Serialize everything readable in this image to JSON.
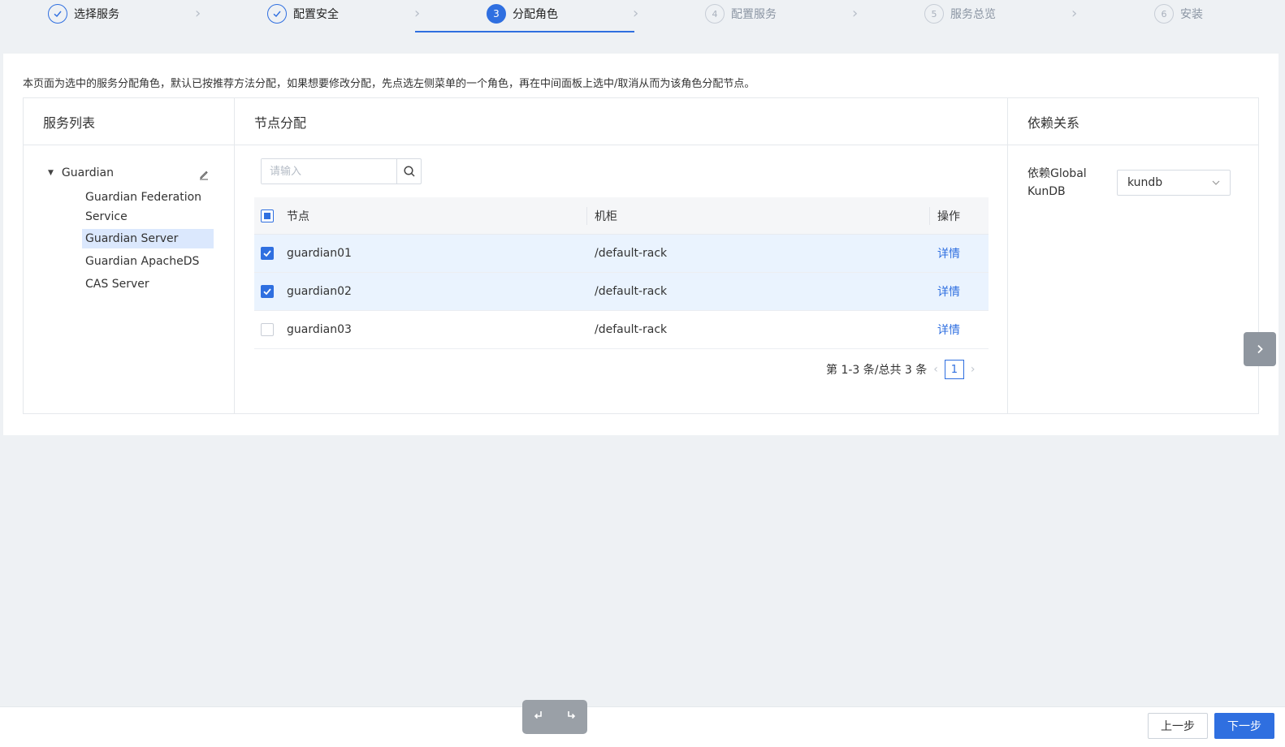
{
  "steps": [
    {
      "index": "1",
      "label": "选择服务",
      "state": "done"
    },
    {
      "index": "2",
      "label": "配置安全",
      "state": "done"
    },
    {
      "index": "3",
      "label": "分配角色",
      "state": "active"
    },
    {
      "index": "4",
      "label": "配置服务",
      "state": "pending"
    },
    {
      "index": "5",
      "label": "服务总览",
      "state": "pending"
    },
    {
      "index": "6",
      "label": "安装",
      "state": "pending"
    }
  ],
  "description": "本页面为选中的服务分配角色，默认已按推荐方法分配，如果想要修改分配，先点选左侧菜单的一个角色，再在中间面板上选中/取消从而为该角色分配节点。",
  "service_list": {
    "title": "服务列表",
    "root": "Guardian",
    "items": [
      {
        "label": "Guardian Federation",
        "label2": "Service",
        "selected": false
      },
      {
        "label": "Guardian Server",
        "selected": true
      },
      {
        "label": "Guardian ApacheDS",
        "selected": false
      },
      {
        "label": "CAS Server",
        "selected": false
      }
    ]
  },
  "node_assign": {
    "title": "节点分配",
    "search_placeholder": "请输入",
    "columns": [
      "节点",
      "机柜",
      "操作"
    ],
    "rows": [
      {
        "node": "guardian01",
        "rack": "/default-rack",
        "action": "详情",
        "checked": true
      },
      {
        "node": "guardian02",
        "rack": "/default-rack",
        "action": "详情",
        "checked": true
      },
      {
        "node": "guardian03",
        "rack": "/default-rack",
        "action": "详情",
        "checked": false
      }
    ],
    "pager": {
      "summary": "第 1-3 条/总共 3 条",
      "current_page": "1"
    }
  },
  "dependencies": {
    "title": "依赖关系",
    "label_line1": "依赖Global",
    "label_line2": "KunDB",
    "selected": "kundb"
  },
  "footer": {
    "prev": "上一步",
    "next": "下一步"
  },
  "colors": {
    "accent": "#2f6fe0",
    "selected_row": "#eaf3fe",
    "tree_selected": "#dbe8fd"
  }
}
